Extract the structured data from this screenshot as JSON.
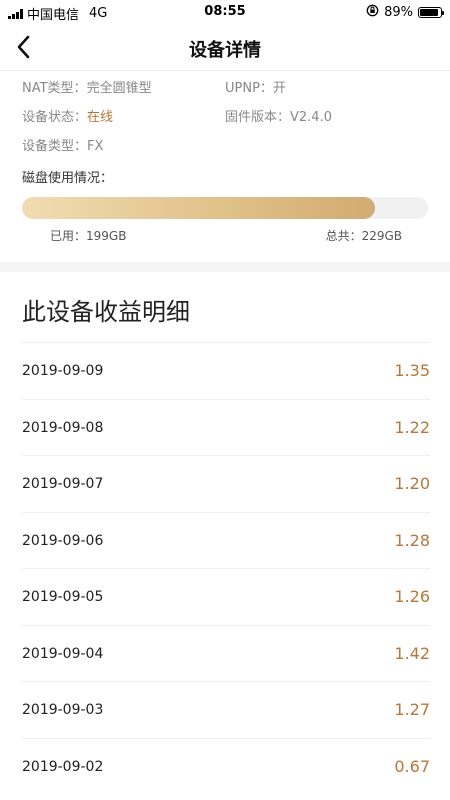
{
  "status_bar": {
    "carrier": "中国电信",
    "network": "4G",
    "time": "08:55",
    "battery": "89%",
    "battery_level": 0.89
  },
  "nav": {
    "title": "设备详情"
  },
  "device_info": {
    "nat_label": "NAT类型：",
    "nat_value": "完全圆锥型",
    "upnp_label": "UPNP：",
    "upnp_value": "开",
    "status_label": "设备状态：",
    "status_value": "在线",
    "firmware_label": "固件版本：",
    "firmware_value": "V2.4.0",
    "type_label": "设备类型：",
    "type_value": "FX"
  },
  "disk": {
    "label": "磁盘使用情况：",
    "used_text": "已用：199GB",
    "total_text": "总共：229GB",
    "used_fraction": 0.869
  },
  "earnings": {
    "title": "此设备收益明细",
    "rows": [
      {
        "date": "2019-09-09",
        "amount": "1.35"
      },
      {
        "date": "2019-09-08",
        "amount": "1.22"
      },
      {
        "date": "2019-09-07",
        "amount": "1.20"
      },
      {
        "date": "2019-09-06",
        "amount": "1.28"
      },
      {
        "date": "2019-09-05",
        "amount": "1.26"
      },
      {
        "date": "2019-09-04",
        "amount": "1.42"
      },
      {
        "date": "2019-09-03",
        "amount": "1.27"
      },
      {
        "date": "2019-09-02",
        "amount": "0.67"
      }
    ]
  },
  "colors": {
    "accent": "#b7773a",
    "progress_start": "#f1dcb2",
    "progress_end": "#d2ab72"
  },
  "icons": {
    "back": "chevron-left-icon",
    "lock_rotation": "orientation-lock-icon",
    "battery": "battery-icon",
    "signal": "signal-bars-icon"
  }
}
